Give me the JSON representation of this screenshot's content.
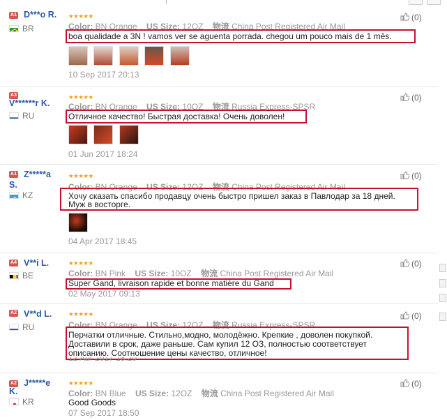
{
  "helpful_label": "(0)",
  "stars": "★★★★★",
  "meta_labels": {
    "color": "Color:",
    "us_size": "US Size:",
    "shipping": "物流"
  },
  "colors": {
    "badge_red": "#d9534f",
    "username": "#2d57a8",
    "highlight": "#c8102e",
    "stars": "#f39c12"
  },
  "reviews": [
    {
      "badge": "A1",
      "badge_color": "#d9534f",
      "name": "D***o R.",
      "name2": "",
      "country": "BR",
      "flag": "brazil-flag",
      "color": "BN Orange",
      "size": "12OZ",
      "shipping": "China Post Registered Air Mail",
      "text1": "boa qualidade a 3N ! vamos ver se aguenta porrada. chegou um pouco mais de 1 mês.",
      "text2": "",
      "date": "10 Sep 2017 20:13",
      "photo_count": 5
    },
    {
      "badge": "A3",
      "badge_color": "#d9534f",
      "name": "V******r K.",
      "name2": "",
      "country": "RU",
      "flag": "russia-flag",
      "color": "BN Orange",
      "size": "10OZ",
      "shipping": "Russia Express-SPSR",
      "text1": "Отличное качество! Быстрая доставка! Очень доволен!",
      "text2": "",
      "date": "01 Jun 2017 18:24",
      "photo_count": 3
    },
    {
      "badge": "A1",
      "badge_color": "#d9534f",
      "name": "Z*****a",
      "name2": "S.",
      "country": "KZ",
      "flag": "kazakhstan-flag",
      "color": "BN Orange",
      "size": "12OZ",
      "shipping": "China Post Registered Air Mail",
      "text1": "Хочу сказать спасибо продавцу очень быстро пришел заказ в Павлодар за 18 дней.",
      "text2": "Муж в восторге.",
      "date": "04 Apr 2017 18:45",
      "photo_count": 1
    },
    {
      "badge": "A4",
      "badge_color": "#d9534f",
      "name": "V**i L.",
      "name2": "",
      "country": "BE",
      "flag": "belgium-flag",
      "color": "BN Pink",
      "size": "10OZ",
      "shipping": "China Post Registered Air Mail",
      "text1": "Super Gand, livraison rapide et bonne matière du Gand",
      "text2": "",
      "date": "02 May 2017 09:13",
      "photo_count": 0
    },
    {
      "badge": "A2",
      "badge_color": "#d9534f",
      "name": "V**d L.",
      "name2": "",
      "country": "RU",
      "flag": "russia-flag",
      "color": "BN Orange",
      "size": "12OZ",
      "shipping": "Russia Express-SPSR",
      "text1": "Перчатки отличные. Стильно,модно, молодёжно. Крепкие , доволен покупкой.",
      "text2": "Доставили в срок, даже раньше. Сам купил 12 ОЗ, полностью соответствует",
      "text3": "описанию. Соотношение цены качество, отличное!",
      "date": "12 Apr 2017 18:20",
      "photo_count": 0
    },
    {
      "badge": "A2",
      "badge_color": "#d9534f",
      "name": "J*****e",
      "name2": "K.",
      "country": "KR",
      "flag": "korea-flag",
      "color": "BN Blue",
      "size": "12OZ",
      "shipping": "China Post Registered Air Mail",
      "text1": "Good Goods",
      "text2": "",
      "date": "07 Sep 2017 18:50",
      "photo_count": 0
    }
  ]
}
